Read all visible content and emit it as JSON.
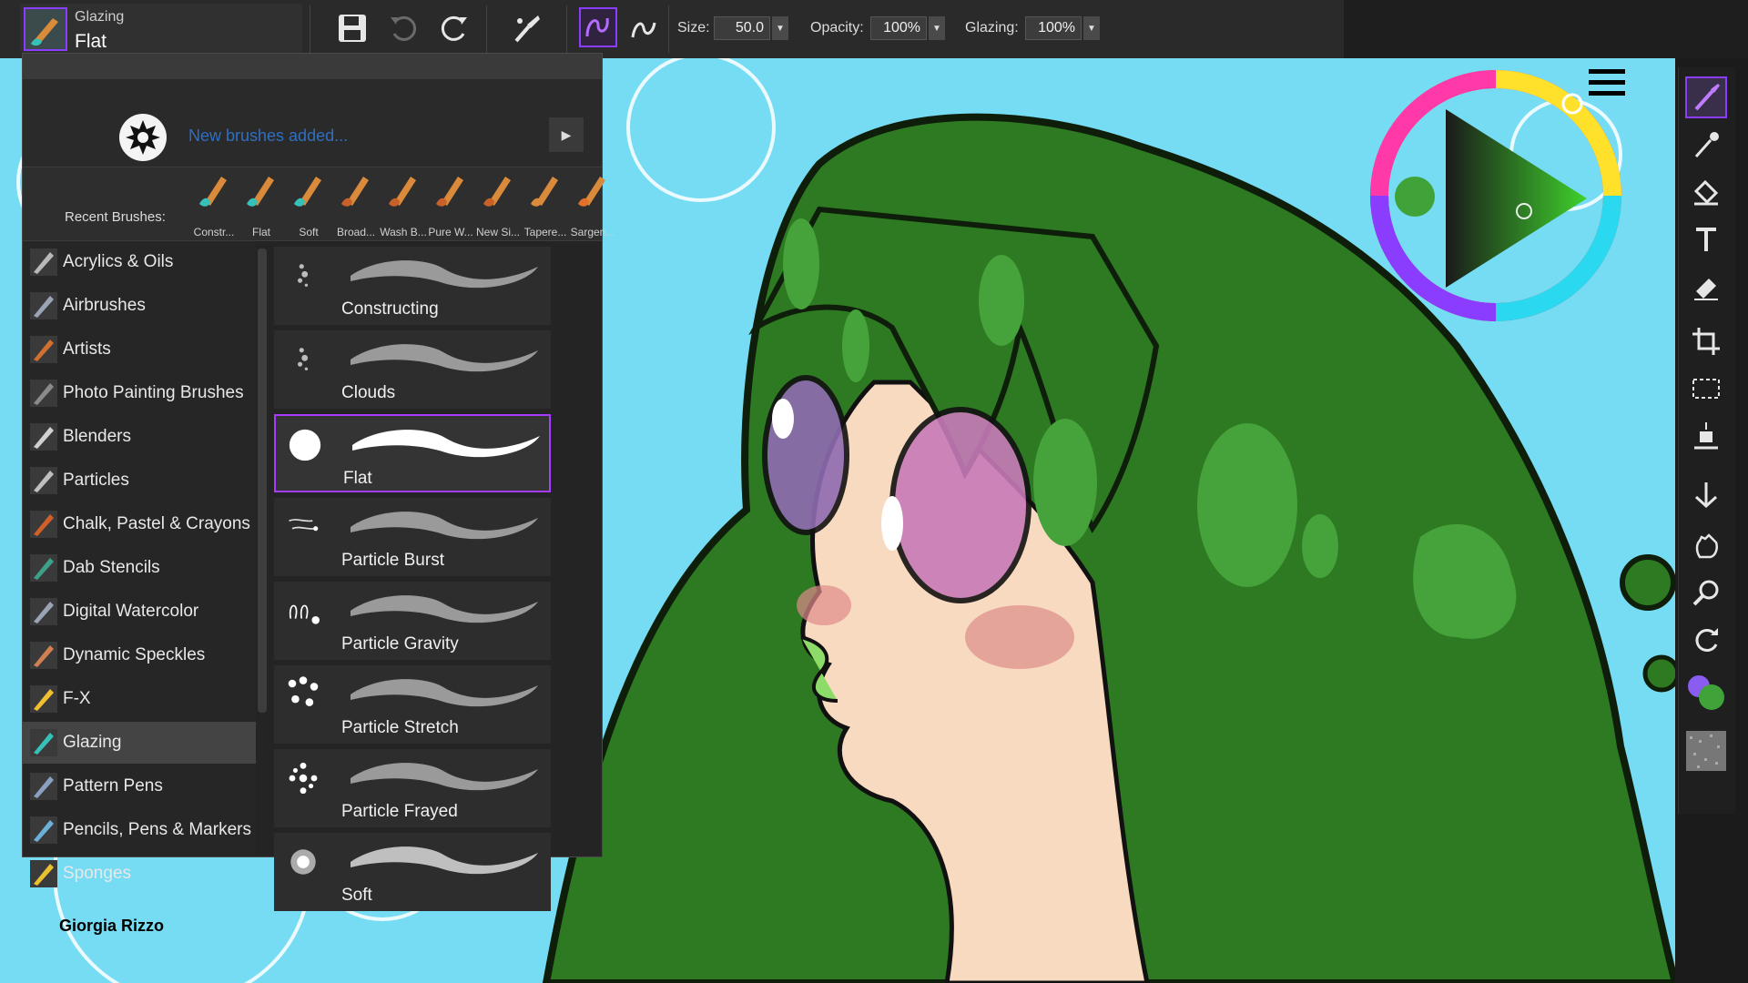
{
  "toolbar": {
    "brush_category": "Glazing",
    "brush_name": "Flat",
    "size_label": "Size:",
    "size_value": "50.0",
    "opacity_label": "Opacity:",
    "opacity_value": "100%",
    "glazing_label": "Glazing:",
    "glazing_value": "100%",
    "buttons": [
      "save-icon",
      "undo-icon",
      "redo-icon",
      "brush-options-icon",
      "stroke-smoothing-icon",
      "stroke-alt-icon"
    ]
  },
  "news": {
    "message": "New brushes added..."
  },
  "recent": {
    "label": "Recent Brushes:",
    "items": [
      "Constr...",
      "Flat",
      "Soft",
      "Broad...",
      "Wash B...",
      "Pure W...",
      "New Si...",
      "Tapere...",
      "Sargen..."
    ]
  },
  "categories": [
    "Acrylics & Oils",
    "Airbrushes",
    "Artists",
    "Photo Painting Brushes",
    "Blenders",
    "Particles",
    "Chalk, Pastel & Crayons",
    "Dab Stencils",
    "Digital Watercolor",
    "Dynamic Speckles",
    "F-X",
    "Glazing",
    "Pattern Pens",
    "Pencils, Pens & Markers",
    "Sponges"
  ],
  "selected_category": "Glazing",
  "variants": [
    "Constructing",
    "Clouds",
    "Flat",
    "Particle Burst",
    "Particle Gravity",
    "Particle Stretch",
    "Particle Frayed",
    "Soft"
  ],
  "selected_variant": "Flat",
  "canvas": {
    "signature": "Giorgia Rizzo"
  },
  "tools": [
    "paintbrush-icon",
    "dropper-icon",
    "paint-bucket-icon",
    "text-icon",
    "eraser-icon",
    "crop-icon",
    "rectangle-select-icon",
    "transform-icon",
    "symmetry-icon",
    "hand-icon",
    "magnifier-icon",
    "rotate-icon",
    "color-swatches-icon",
    "paper-texture-icon"
  ],
  "colors": {
    "accent": "#8a3cff",
    "main_color": "#3fa33a",
    "secondary_color": "#8a5cf0",
    "sky": "#76dcf4",
    "hair": "#2d7a22"
  }
}
